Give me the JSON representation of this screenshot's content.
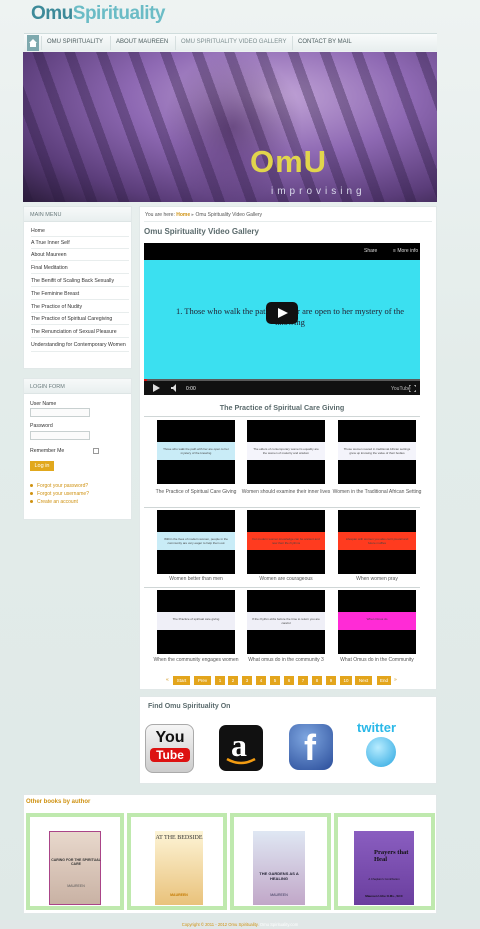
{
  "logo": {
    "part1": "Omu",
    "part2": "Spirituality"
  },
  "nav": {
    "items": [
      "OMU SPIRITUALITY",
      "ABOUT MAUREEN",
      "OMU SPIRITUALITY VIDEO GALLERY",
      "CONTACT BY MAIL"
    ],
    "active": "OMU SPIRITUALITY VIDEO GALLERY"
  },
  "banner": {
    "title": "OmU",
    "subtitle": "improvising"
  },
  "main_menu": {
    "heading": "MAIN MENU",
    "items": [
      "Home",
      "A True Inner Self",
      "About Maureen",
      "Final Meditation",
      "The Benifit of Scaling Back Sexually",
      "The Feminine Breast",
      "The Practice of Nudity",
      "The Practice of Spiritual Caregiving",
      "The Renunciation of Sexual Pleasure",
      "Understanding for Contemporary Women"
    ]
  },
  "login": {
    "heading": "LOGIN FORM",
    "username_label": "User Name",
    "password_label": "Password",
    "remember_label": "Remember Me",
    "button_label": "Log in",
    "links": [
      "Forgot your password?",
      "Forgot your username?",
      "Create an account"
    ]
  },
  "breadcrumb": {
    "prefix": "You are here:",
    "home": "Home",
    "sep": "▸",
    "current": "Omu Spirituality Video Gallery"
  },
  "page_title": "Omu Spirituality Video Gallery",
  "video": {
    "caption": "1. Those who walk the path with her are open to her mystery of the knowing",
    "time": "0:00",
    "share": "Share",
    "more": "More info",
    "brand": "YouTube",
    "progress": 0.01
  },
  "gallery": {
    "title": "The Practice of Spiritual Care Giving",
    "videos": [
      {
        "title": "The Practice of Spiritual Care Giving",
        "slide_text": "Those who walk the path with her are open to her mystery of the knowing",
        "bg": "#c9ecf7"
      },
      {
        "title": "Women should examine their inner lives",
        "slide_text": "The elders of contemporary women's equality are the women of maturity and wisdom",
        "bg": "#f4f4fb"
      },
      {
        "title": "Women in the Traditional African Setting",
        "slide_text": "Those women reared in traditional African settings grew up knowing the value of their bodies",
        "bg": "#f4f4fb"
      },
      {
        "title": "Women better than men",
        "slide_text": "Within the lives of modern women, people in the community are very eager to help them out",
        "bg": "#c9ecf7"
      },
      {
        "title": "Women are courageous",
        "slide_text": "For modern women knowledge can be ancient and now their life rhythms",
        "bg": "#ff3b1f"
      },
      {
        "title": "When women pray",
        "slide_text": "Lifespan with women you also can't prevail and future muffles",
        "bg": "#ff3b1f"
      },
      {
        "title": "When the community engages women",
        "slide_text": "The Practice of spiritual care giving",
        "bg": "#efeff7"
      },
      {
        "title": "What omus do in the community 3",
        "slide_text": "If the rhythm ebbs before the time to return you are careful",
        "bg": "#efeff7"
      },
      {
        "title": "What Omus do in the Community",
        "slide_text": "When Omus do",
        "bg": "#ff2bd6"
      }
    ]
  },
  "pager": {
    "prev_marker": "«",
    "next_marker": "»",
    "buttons": [
      "Start",
      "Prev",
      "1",
      "2",
      "3",
      "4",
      "5",
      "6",
      "7",
      "8",
      "9",
      "10",
      "Next",
      "End"
    ]
  },
  "social": {
    "heading": "Find Omu Spirituality On",
    "items": [
      {
        "name": "YouTube",
        "label_top": "You",
        "label_bottom": "Tube"
      },
      {
        "name": "Amazon",
        "label": "a"
      },
      {
        "name": "Facebook",
        "label": "f"
      },
      {
        "name": "Twitter",
        "label": "twitter"
      }
    ]
  },
  "books": {
    "heading": "Other books by author",
    "items": [
      {
        "title": "CARING FOR THE SPIRITUAL CARE",
        "author": "MAUREEN",
        "color": "#e5d3c9"
      },
      {
        "title": "AT THE BEDSIDE",
        "author": "MAUREEN",
        "color": "#ecd6a1"
      },
      {
        "title": "THE GARDENS AS A HEALING",
        "author": "MAUREEN",
        "color": "#cdd7e3"
      },
      {
        "title": "Prayers that Heal",
        "subtitle": "A Chaplain's Contribution",
        "author": "Maureen Uche O.Ms., SCC",
        "color": "#7c4fb0"
      }
    ]
  },
  "footer": {
    "text": "Copyright © 2011 - 2012 Omu Spirituality.",
    "link": "Omu Spirituality.com"
  }
}
